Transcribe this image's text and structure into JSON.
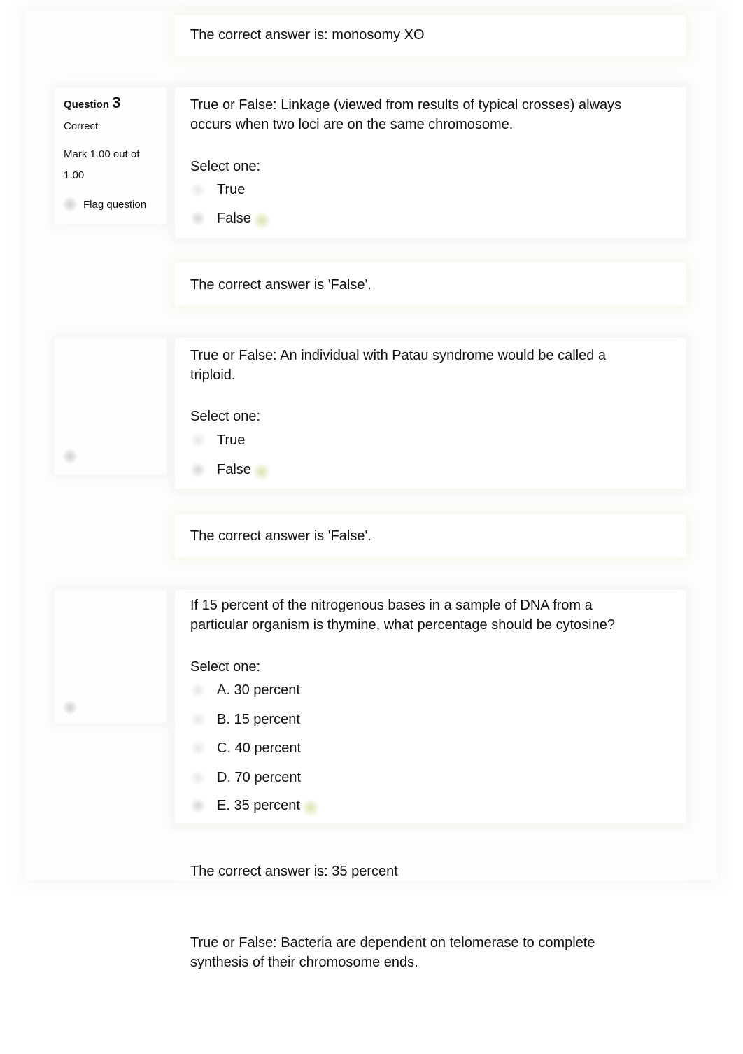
{
  "questions": [
    {
      "feedback": "The correct answer is: monosomy XO"
    },
    {
      "info": {
        "label": "Question",
        "number": "3",
        "state": "Correct",
        "mark_line1": "Mark 1.00 out of",
        "mark_line2": "1.00",
        "flag_label": "Flag question"
      },
      "text_line1": "True or False: Linkage (viewed from results of typical crosses) always",
      "text_line2": "occurs when two loci are on the same chromosome.",
      "prompt": "Select one:",
      "options": [
        {
          "label": "True",
          "selected": false,
          "correct": false
        },
        {
          "label": "False",
          "selected": true,
          "correct": true
        }
      ],
      "feedback": "The correct answer is 'False'."
    },
    {
      "text_line1": "True or False: An individual with Patau syndrome would be called a",
      "text_line2": "triploid.",
      "prompt": "Select one:",
      "options": [
        {
          "label": "True",
          "selected": false,
          "correct": false
        },
        {
          "label": "False",
          "selected": true,
          "correct": true
        }
      ],
      "feedback": "The correct answer is 'False'."
    },
    {
      "text_line1": "If 15 percent of the nitrogenous bases in a sample of DNA from a",
      "text_line2": "particular organism is thymine, what percentage should be cytosine?",
      "prompt": "Select one:",
      "options": [
        {
          "label": "A. 30 percent",
          "selected": false,
          "correct": false
        },
        {
          "label": "B. 15 percent",
          "selected": false,
          "correct": false
        },
        {
          "label": "C. 40 percent",
          "selected": false,
          "correct": false
        },
        {
          "label": "D. 70 percent",
          "selected": false,
          "correct": false
        },
        {
          "label": "E. 35 percent",
          "selected": true,
          "correct": true
        }
      ],
      "feedback": "The correct answer is: 35 percent"
    },
    {
      "text_line1": "True or False: Bacteria are dependent on telomerase to complete",
      "text_line2": "synthesis of their chromosome ends."
    }
  ],
  "colors": {
    "correct_indicator": "#d6e2aa",
    "text": "#111111"
  }
}
